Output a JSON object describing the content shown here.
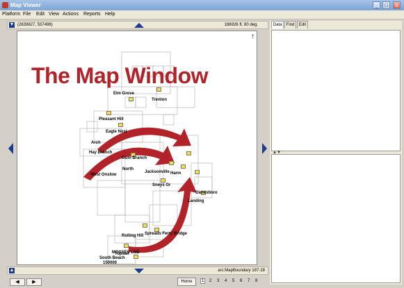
{
  "window": {
    "title": "Map Viewer",
    "minimize": "_",
    "maximize": "□",
    "close": "x"
  },
  "menu": [
    "Platform",
    "File",
    "Edit",
    "View",
    "Actions",
    "Reports",
    "Help"
  ],
  "map": {
    "coords": "(2639827, 537498)",
    "scale": "186926 ft. 80 deg.",
    "north_arrow": "↑",
    "overlay_title": "The Map Window",
    "places": [
      "Elm Grove",
      "Trenton",
      "Pleasant Hill",
      "Eagle Nest",
      "Arch",
      "Hay Branch",
      "Gum Branch",
      "West Onslow",
      "North",
      "Harm",
      "Sneys Gr",
      "Jacksonville",
      "Landing",
      "Rolling Hill",
      "Spreads Ferry Bridge",
      "MOSSES LND",
      "Topsail",
      "South Beach",
      "Oanesboro"
    ],
    "scale_number": "150000",
    "boundary": "arc:MapBoundary 187-28"
  },
  "panel": {
    "tabs": [
      "Data",
      "Find",
      "Edit"
    ],
    "active_tab": "Data"
  },
  "bottom": {
    "back": "◀",
    "forward": "▶",
    "home": "Home",
    "pages": [
      "1",
      "2",
      "3",
      "4",
      "5",
      "6",
      "7",
      "8"
    ],
    "current_page": "1"
  },
  "colors": {
    "accent": "#b22229",
    "nav": "#1c3a8c"
  }
}
